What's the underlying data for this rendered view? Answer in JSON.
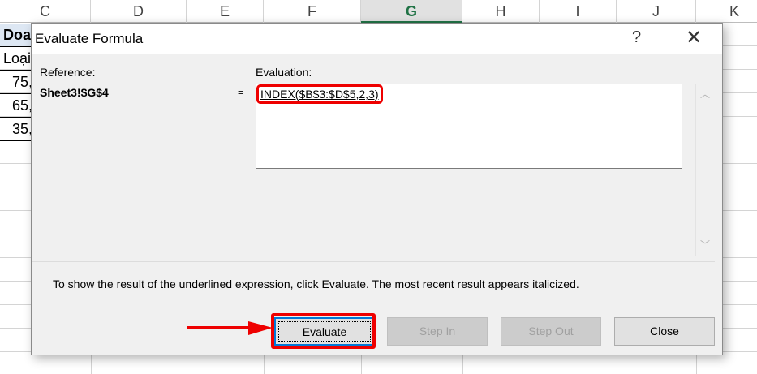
{
  "spreadsheet": {
    "columns": [
      "C",
      "D",
      "E",
      "F",
      "G",
      "H",
      "I",
      "J",
      "K"
    ],
    "selected_column": "G",
    "cells": [
      "Doa",
      "Loại",
      "75,",
      "65,",
      "35,"
    ]
  },
  "dialog": {
    "title": "Evaluate Formula",
    "help_label": "?",
    "reference_label": "Reference:",
    "reference_value": "Sheet3!$G$4",
    "equals": "=",
    "evaluation_label": "Evaluation:",
    "evaluation_formula": "INDEX($B$3:$D$5,2,3)",
    "hint": "To show the result of the underlined expression, click Evaluate.  The most recent result appears italicized.",
    "buttons": {
      "evaluate": "Evaluate",
      "step_in": "Step In",
      "step_out": "Step Out",
      "close": "Close"
    }
  },
  "colors": {
    "highlight": "#e00000",
    "selected_header": "#217346"
  }
}
